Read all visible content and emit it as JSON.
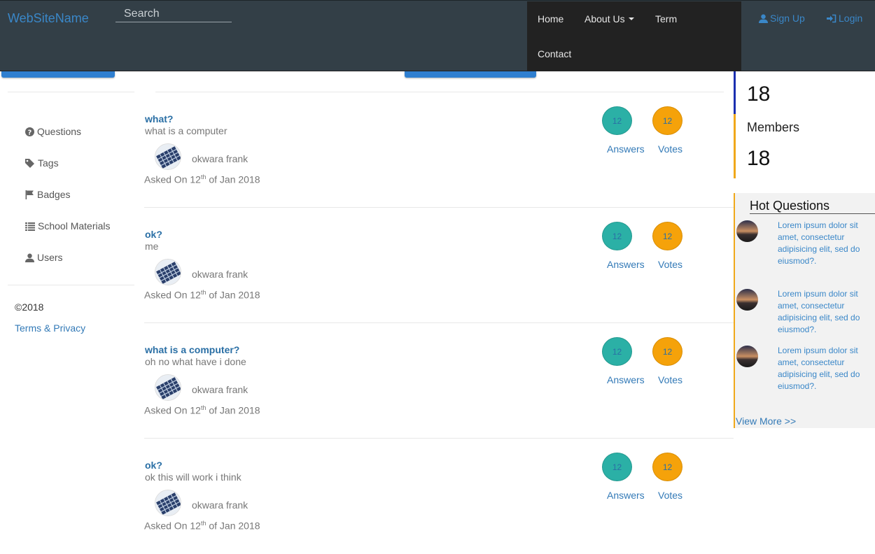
{
  "navbar": {
    "brand": "WebSiteName",
    "search_placeholder": "Search",
    "menu": {
      "home": "Home",
      "about": "About Us",
      "term": "Term",
      "contact": "Contact"
    },
    "signup": "Sign Up",
    "login": "Login"
  },
  "sidebar": {
    "items": [
      {
        "label": "Questions",
        "icon": "question-circle-icon"
      },
      {
        "label": "Tags",
        "icon": "tag-icon"
      },
      {
        "label": "Badges",
        "icon": "flag-icon"
      },
      {
        "label": "School Materials",
        "icon": "list-icon"
      },
      {
        "label": "Users",
        "icon": "user-icon"
      }
    ],
    "copyright": "©2018",
    "terms": "Terms & Privacy"
  },
  "questions": [
    {
      "title": "what?",
      "body": "what is a computer",
      "author": "okwara frank",
      "asked_prefix": "Asked On 12",
      "asked_sup": "th",
      "asked_suffix": " of Jan 2018",
      "answers": "12",
      "votes": "12"
    },
    {
      "title": "ok?",
      "body": "me",
      "author": "okwara frank",
      "asked_prefix": "Asked On 12",
      "asked_sup": "th",
      "asked_suffix": " of Jan 2018",
      "answers": "12",
      "votes": "12"
    },
    {
      "title": "what is a computer?",
      "body": "oh no what have i done",
      "author": "okwara frank",
      "asked_prefix": "Asked On 12",
      "asked_sup": "th",
      "asked_suffix": " of Jan 2018",
      "answers": "12",
      "votes": "12"
    },
    {
      "title": "ok?",
      "body": "ok this will work i think",
      "author": "okwara frank",
      "asked_prefix": "Asked On 12",
      "asked_sup": "th",
      "asked_suffix": " of Jan 2018",
      "answers": "12",
      "votes": "12"
    }
  ],
  "labels": {
    "answers": "Answers",
    "votes": "Votes"
  },
  "stats": {
    "top_count": "18",
    "members_label": "Members",
    "members_count": "18"
  },
  "hot_questions": {
    "title": "Hot Questions",
    "items": [
      "Lorem ipsum dolor sit amet, consectetur adipisicing elit, sed do eiusmod?.",
      "Lorem ipsum dolor sit amet, consectetur adipisicing elit, sed do eiusmod?.",
      "Lorem ipsum dolor sit amet, consectetur adipisicing elit, sed do eiusmod?."
    ],
    "view_more": "View More >>"
  },
  "colors": {
    "navbar": "#333f47",
    "brand": "#3a87c8",
    "answers": "#2bb0a6",
    "votes": "#f5a20a",
    "link": "#337ab7"
  }
}
